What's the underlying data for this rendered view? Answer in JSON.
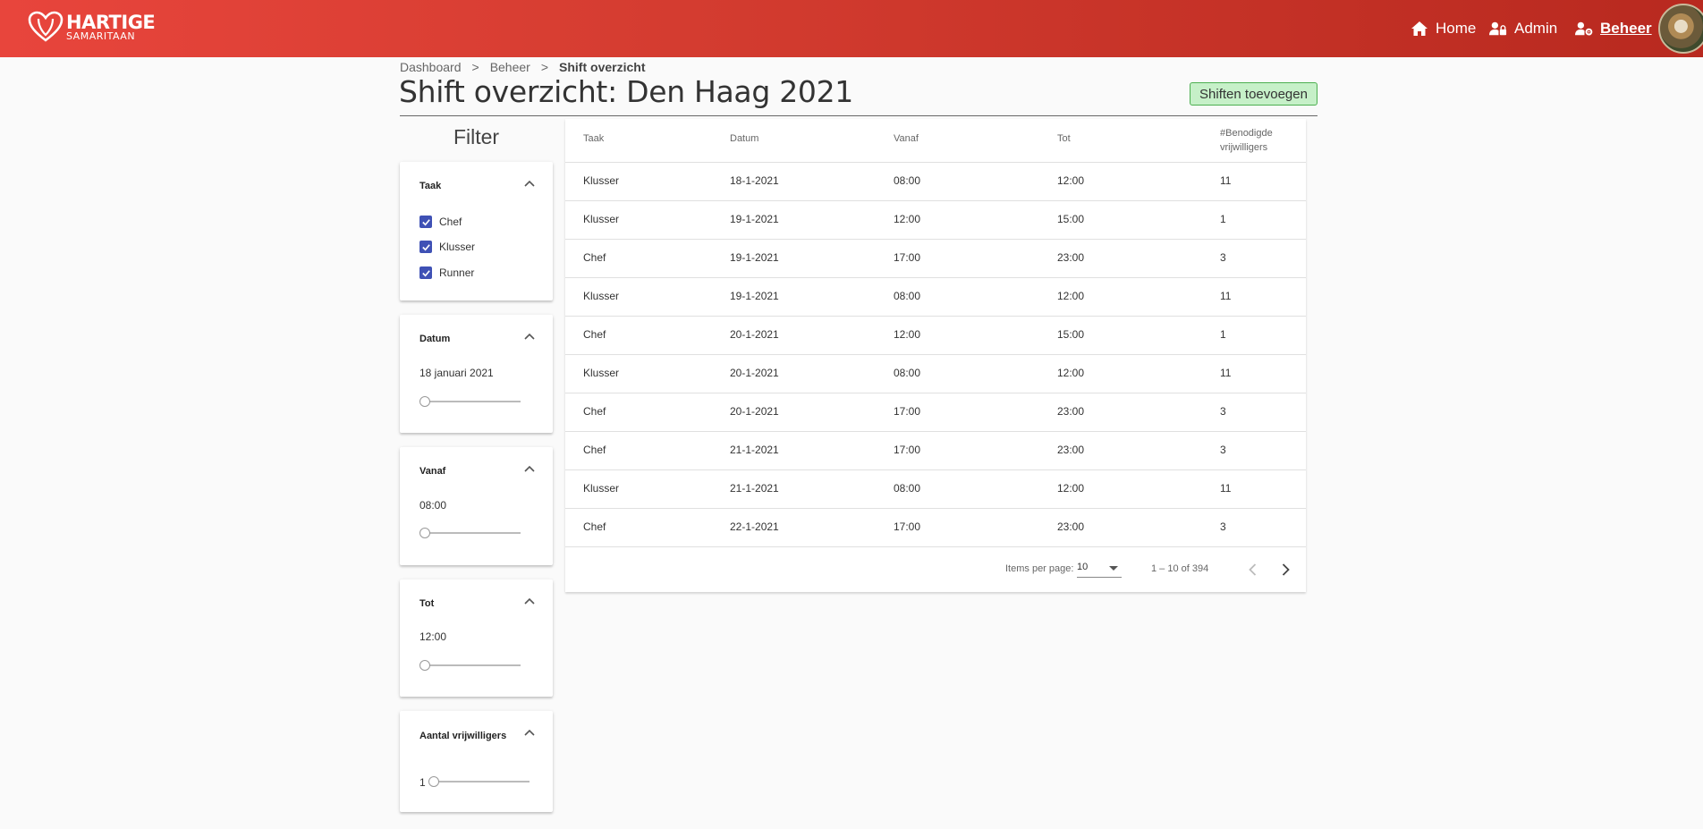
{
  "header": {
    "logo": {
      "line1": "HARTIGE",
      "line2": "SAMARITAAN"
    },
    "nav": [
      {
        "label": "Home",
        "icon": "home-icon"
      },
      {
        "label": "Admin",
        "icon": "user-lock-icon"
      },
      {
        "label": "Beheer",
        "icon": "user-cog-icon",
        "active": true
      }
    ],
    "colors": {
      "bar_start": "#e8453c",
      "bar_end": "#b8291f"
    }
  },
  "breadcrumb": {
    "items": [
      "Dashboard",
      "Beheer"
    ],
    "current": "Shift overzicht",
    "separator": ">"
  },
  "page": {
    "title": "Shift overzicht: Den Haag 2021",
    "add_button": "Shiften toevoegen"
  },
  "filter": {
    "title": "Filter",
    "taak": {
      "label": "Taak",
      "options": [
        {
          "label": "Chef",
          "checked": true
        },
        {
          "label": "Klusser",
          "checked": true
        },
        {
          "label": "Runner",
          "checked": true
        }
      ]
    },
    "datum": {
      "label": "Datum",
      "value": "18 januari 2021",
      "slider_fraction": 0
    },
    "vanaf": {
      "label": "Vanaf",
      "value": "08:00",
      "slider_fraction": 0
    },
    "tot": {
      "label": "Tot",
      "value": "12:00",
      "slider_fraction": 0
    },
    "aantal": {
      "label": "Aantal vrijwilligers",
      "value": "1",
      "slider_fraction": 0
    }
  },
  "table": {
    "columns": [
      "Taak",
      "Datum",
      "Vanaf",
      "Tot",
      "#Benodigde",
      "vrijwilligers"
    ],
    "rows": [
      [
        "Klusser",
        "18-1-2021",
        "08:00",
        "12:00",
        "11"
      ],
      [
        "Klusser",
        "19-1-2021",
        "12:00",
        "15:00",
        "1"
      ],
      [
        "Chef",
        "19-1-2021",
        "17:00",
        "23:00",
        "3"
      ],
      [
        "Klusser",
        "19-1-2021",
        "08:00",
        "12:00",
        "11"
      ],
      [
        "Chef",
        "20-1-2021",
        "12:00",
        "15:00",
        "1"
      ],
      [
        "Klusser",
        "20-1-2021",
        "08:00",
        "12:00",
        "11"
      ],
      [
        "Chef",
        "20-1-2021",
        "17:00",
        "23:00",
        "3"
      ],
      [
        "Chef",
        "21-1-2021",
        "17:00",
        "23:00",
        "3"
      ],
      [
        "Klusser",
        "21-1-2021",
        "08:00",
        "12:00",
        "11"
      ],
      [
        "Chef",
        "22-1-2021",
        "17:00",
        "23:00",
        "3"
      ]
    ],
    "paginator": {
      "items_label": "Items per page:",
      "page_size": "10",
      "range": "1 – 10 of 394"
    }
  }
}
